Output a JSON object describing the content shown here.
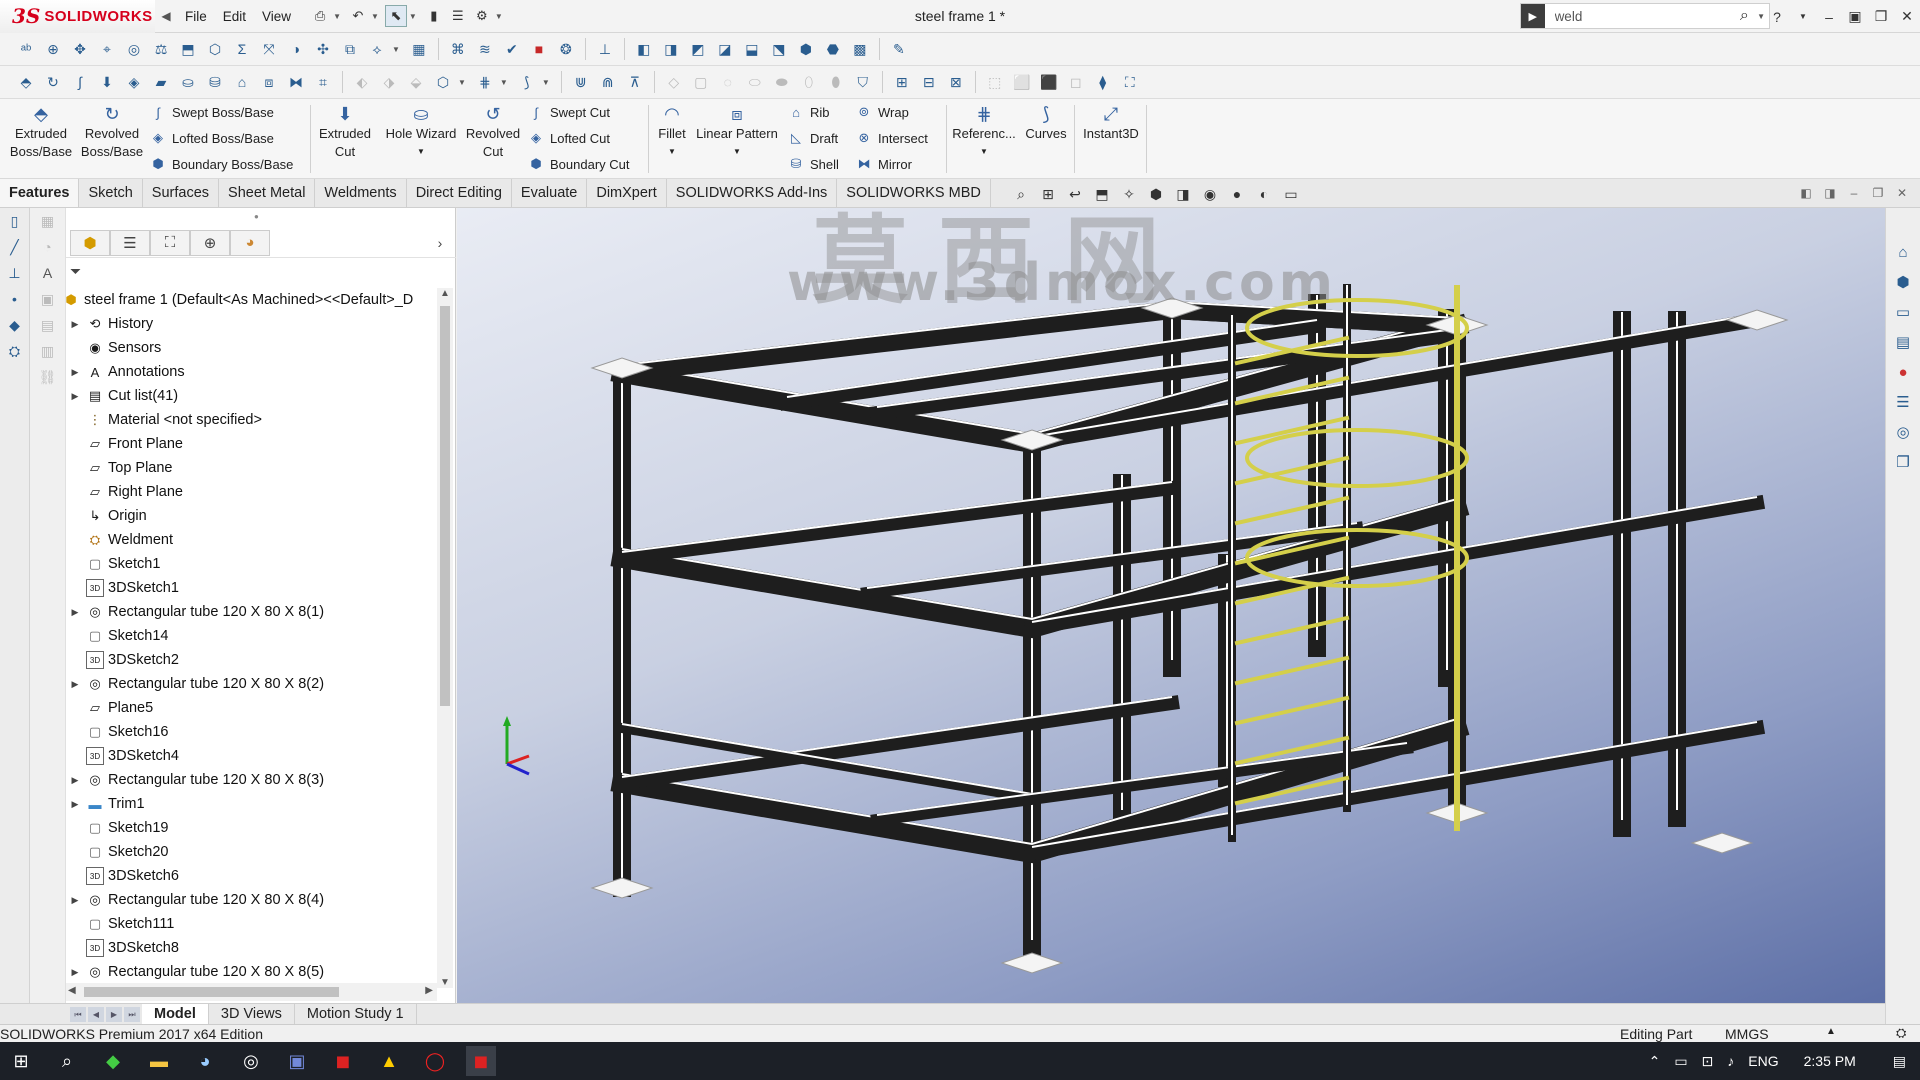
{
  "app": {
    "logo_ds": "3S",
    "logo_name": "SOLIDWORKS",
    "document_title": "steel frame 1 *"
  },
  "menu": [
    "File",
    "Edit",
    "View"
  ],
  "search": {
    "value": "weld"
  },
  "command_manager": {
    "extruded_boss": "Extruded Boss/Base",
    "revolved_boss": "Revolved Boss/Base",
    "swept_boss": "Swept Boss/Base",
    "lofted_boss": "Lofted Boss/Base",
    "boundary_boss": "Boundary Boss/Base",
    "extruded_cut": "Extruded Cut",
    "hole_wizard": "Hole Wizard",
    "revolved_cut": "Revolved Cut",
    "swept_cut": "Swept Cut",
    "lofted_cut": "Lofted Cut",
    "boundary_cut": "Boundary Cut",
    "fillet": "Fillet",
    "linear_pattern": "Linear Pattern",
    "rib": "Rib",
    "draft": "Draft",
    "shell": "Shell",
    "wrap": "Wrap",
    "intersect": "Intersect",
    "mirror": "Mirror",
    "reference": "Referenc...",
    "curves": "Curves",
    "instant3d": "Instant3D"
  },
  "tabs": [
    "Features",
    "Sketch",
    "Surfaces",
    "Sheet Metal",
    "Weldments",
    "Direct Editing",
    "Evaluate",
    "DimXpert",
    "SOLIDWORKS Add-Ins",
    "SOLIDWORKS MBD"
  ],
  "feature_tree": {
    "root": "steel frame 1  (Default<As Machined><<Default>_D",
    "items": [
      {
        "label": "History",
        "icon": "history-icon",
        "expand": true
      },
      {
        "label": "Sensors",
        "icon": "sensors-icon",
        "expand": false
      },
      {
        "label": "Annotations",
        "icon": "annotations-icon",
        "expand": true
      },
      {
        "label": "Cut list(41)",
        "icon": "cut-list-icon",
        "expand": true
      },
      {
        "label": "Material <not specified>",
        "icon": "material-icon",
        "expand": false
      },
      {
        "label": "Front Plane",
        "icon": "plane-icon",
        "expand": false
      },
      {
        "label": "Top Plane",
        "icon": "plane-icon",
        "expand": false
      },
      {
        "label": "Right Plane",
        "icon": "plane-icon",
        "expand": false
      },
      {
        "label": "Origin",
        "icon": "origin-icon",
        "expand": false
      },
      {
        "label": "Weldment",
        "icon": "weldment-icon",
        "expand": false
      },
      {
        "label": "Sketch1",
        "icon": "sketch-icon",
        "expand": false
      },
      {
        "label": "3DSketch1",
        "icon": "3dsketch-icon",
        "expand": false
      },
      {
        "label": "Rectangular tube 120 X 80 X 8(1)",
        "icon": "structural-member-icon",
        "expand": true
      },
      {
        "label": "Sketch14",
        "icon": "sketch-icon",
        "expand": false
      },
      {
        "label": "3DSketch2",
        "icon": "3dsketch-icon",
        "expand": false
      },
      {
        "label": "Rectangular tube 120 X 80 X 8(2)",
        "icon": "structural-member-icon",
        "expand": true
      },
      {
        "label": "Plane5",
        "icon": "plane-icon",
        "expand": false
      },
      {
        "label": "Sketch16",
        "icon": "sketch-icon",
        "expand": false
      },
      {
        "label": "3DSketch4",
        "icon": "3dsketch-icon",
        "expand": false
      },
      {
        "label": "Rectangular tube 120 X 80 X 8(3)",
        "icon": "structural-member-icon",
        "expand": true
      },
      {
        "label": "Trim1",
        "icon": "folder-icon",
        "expand": true
      },
      {
        "label": "Sketch19",
        "icon": "sketch-icon",
        "expand": false
      },
      {
        "label": "Sketch20",
        "icon": "sketch-icon",
        "expand": false
      },
      {
        "label": "3DSketch6",
        "icon": "3dsketch-icon",
        "expand": false
      },
      {
        "label": "Rectangular tube 120 X 80 X 8(4)",
        "icon": "structural-member-icon",
        "expand": true
      },
      {
        "label": "Sketch111",
        "icon": "sketch-icon",
        "expand": false
      },
      {
        "label": "3DSketch8",
        "icon": "3dsketch-icon",
        "expand": false
      },
      {
        "label": "Rectangular tube 120 X 80 X 8(5)",
        "icon": "structural-member-icon",
        "expand": true
      }
    ]
  },
  "bottom_tabs": [
    "Model",
    "3D Views",
    "Motion Study 1"
  ],
  "status": {
    "left": "SOLIDWORKS Premium 2017 x64 Edition",
    "mode": "Editing Part",
    "units": "MMGS"
  },
  "watermark": {
    "line1": "莫西网",
    "line2": "www.3dmox.com"
  },
  "taskbar": {
    "lang": "ENG",
    "time": "2:35 PM"
  },
  "colors": {
    "brand": "#d6001c",
    "steel": "#1e1e1e",
    "ladder": "#d4cf4a"
  }
}
